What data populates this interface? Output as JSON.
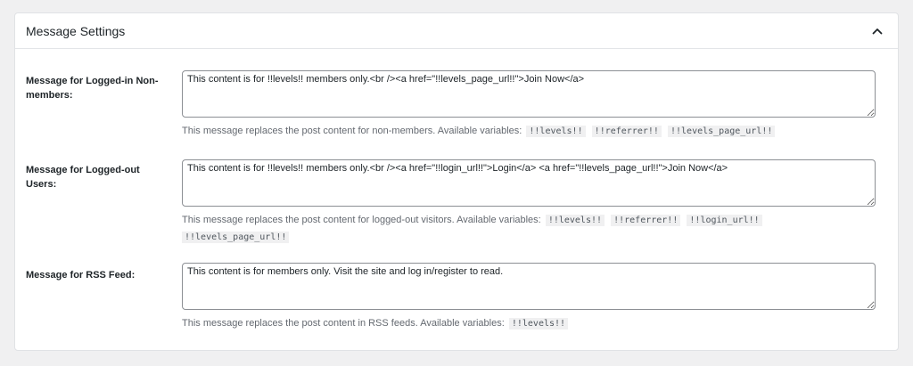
{
  "panel": {
    "title": "Message Settings",
    "collapse_icon": "chevron-up-icon"
  },
  "fields": [
    {
      "label": "Message for Logged-in Non-members:",
      "value": "This content is for !!levels!! members only.<br /><a href=\"!!levels_page_url!!\">Join Now</a>",
      "description": "This message replaces the post content for non-members. Available variables:",
      "variables": [
        "!!levels!!",
        "!!referrer!!",
        "!!levels_page_url!!"
      ]
    },
    {
      "label": "Message for Logged-out Users:",
      "value": "This content is for !!levels!! members only.<br /><a href=\"!!login_url!!\">Login</a> <a href=\"!!levels_page_url!!\">Join Now</a>",
      "description": "This message replaces the post content for logged-out visitors. Available variables:",
      "variables": [
        "!!levels!!",
        "!!referrer!!",
        "!!login_url!!",
        "!!levels_page_url!!"
      ]
    },
    {
      "label": "Message for RSS Feed:",
      "value": "This content is for members only. Visit the site and log in/register to read.",
      "description": "This message replaces the post content in RSS feeds. Available variables:",
      "variables": [
        "!!levels!!"
      ]
    }
  ]
}
